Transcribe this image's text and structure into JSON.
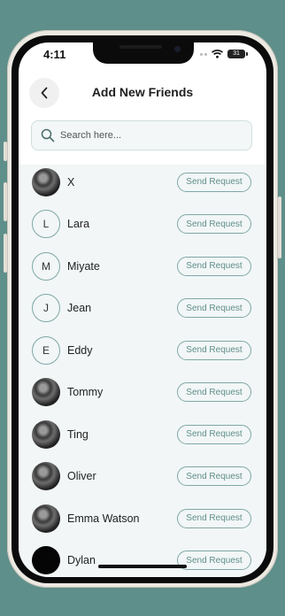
{
  "status": {
    "time": "4:11",
    "battery": "31"
  },
  "header": {
    "title": "Add New Friends"
  },
  "search": {
    "placeholder": "Search here..."
  },
  "friends": [
    {
      "name": "X",
      "avatar_type": "photo",
      "initial": "",
      "action": "Send Request"
    },
    {
      "name": "Lara",
      "avatar_type": "letter",
      "initial": "L",
      "action": "Send Request"
    },
    {
      "name": "Miyate",
      "avatar_type": "letter",
      "initial": "M",
      "action": "Send Request"
    },
    {
      "name": "Jean",
      "avatar_type": "letter",
      "initial": "J",
      "action": "Send Request"
    },
    {
      "name": "Eddy",
      "avatar_type": "letter",
      "initial": "E",
      "action": "Send Request"
    },
    {
      "name": "Tommy",
      "avatar_type": "photo",
      "initial": "",
      "action": "Send Request"
    },
    {
      "name": "Ting",
      "avatar_type": "photo",
      "initial": "",
      "action": "Send Request"
    },
    {
      "name": "Oliver",
      "avatar_type": "photo",
      "initial": "",
      "action": "Send Request"
    },
    {
      "name": "Emma Watson",
      "avatar_type": "photo",
      "initial": "",
      "action": "Send Request"
    },
    {
      "name": "Dylan",
      "avatar_type": "blank",
      "initial": "",
      "action": "Send Request"
    }
  ],
  "colors": {
    "accent": "#5f8f8a",
    "list_bg": "#f2f6f6",
    "background": "#5f8f8a"
  },
  "icons": {
    "back": "chevron-left-icon",
    "search": "search-icon",
    "wifi": "wifi-icon",
    "signal": "signal-icon",
    "battery": "battery-icon"
  }
}
